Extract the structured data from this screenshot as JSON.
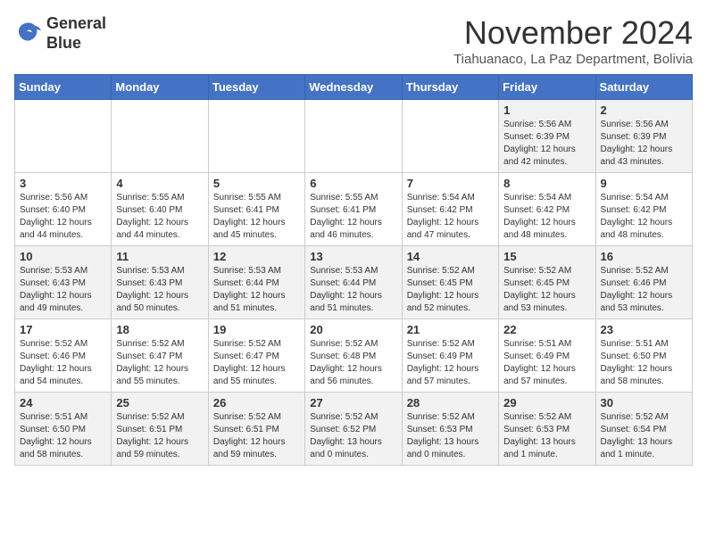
{
  "logo": {
    "line1": "General",
    "line2": "Blue"
  },
  "title": "November 2024",
  "subtitle": "Tiahuanaco, La Paz Department, Bolivia",
  "days_of_week": [
    "Sunday",
    "Monday",
    "Tuesday",
    "Wednesday",
    "Thursday",
    "Friday",
    "Saturday"
  ],
  "weeks": [
    [
      {
        "day": "",
        "info": ""
      },
      {
        "day": "",
        "info": ""
      },
      {
        "day": "",
        "info": ""
      },
      {
        "day": "",
        "info": ""
      },
      {
        "day": "",
        "info": ""
      },
      {
        "day": "1",
        "info": "Sunrise: 5:56 AM\nSunset: 6:39 PM\nDaylight: 12 hours\nand 42 minutes."
      },
      {
        "day": "2",
        "info": "Sunrise: 5:56 AM\nSunset: 6:39 PM\nDaylight: 12 hours\nand 43 minutes."
      }
    ],
    [
      {
        "day": "3",
        "info": "Sunrise: 5:56 AM\nSunset: 6:40 PM\nDaylight: 12 hours\nand 44 minutes."
      },
      {
        "day": "4",
        "info": "Sunrise: 5:55 AM\nSunset: 6:40 PM\nDaylight: 12 hours\nand 44 minutes."
      },
      {
        "day": "5",
        "info": "Sunrise: 5:55 AM\nSunset: 6:41 PM\nDaylight: 12 hours\nand 45 minutes."
      },
      {
        "day": "6",
        "info": "Sunrise: 5:55 AM\nSunset: 6:41 PM\nDaylight: 12 hours\nand 46 minutes."
      },
      {
        "day": "7",
        "info": "Sunrise: 5:54 AM\nSunset: 6:42 PM\nDaylight: 12 hours\nand 47 minutes."
      },
      {
        "day": "8",
        "info": "Sunrise: 5:54 AM\nSunset: 6:42 PM\nDaylight: 12 hours\nand 48 minutes."
      },
      {
        "day": "9",
        "info": "Sunrise: 5:54 AM\nSunset: 6:42 PM\nDaylight: 12 hours\nand 48 minutes."
      }
    ],
    [
      {
        "day": "10",
        "info": "Sunrise: 5:53 AM\nSunset: 6:43 PM\nDaylight: 12 hours\nand 49 minutes."
      },
      {
        "day": "11",
        "info": "Sunrise: 5:53 AM\nSunset: 6:43 PM\nDaylight: 12 hours\nand 50 minutes."
      },
      {
        "day": "12",
        "info": "Sunrise: 5:53 AM\nSunset: 6:44 PM\nDaylight: 12 hours\nand 51 minutes."
      },
      {
        "day": "13",
        "info": "Sunrise: 5:53 AM\nSunset: 6:44 PM\nDaylight: 12 hours\nand 51 minutes."
      },
      {
        "day": "14",
        "info": "Sunrise: 5:52 AM\nSunset: 6:45 PM\nDaylight: 12 hours\nand 52 minutes."
      },
      {
        "day": "15",
        "info": "Sunrise: 5:52 AM\nSunset: 6:45 PM\nDaylight: 12 hours\nand 53 minutes."
      },
      {
        "day": "16",
        "info": "Sunrise: 5:52 AM\nSunset: 6:46 PM\nDaylight: 12 hours\nand 53 minutes."
      }
    ],
    [
      {
        "day": "17",
        "info": "Sunrise: 5:52 AM\nSunset: 6:46 PM\nDaylight: 12 hours\nand 54 minutes."
      },
      {
        "day": "18",
        "info": "Sunrise: 5:52 AM\nSunset: 6:47 PM\nDaylight: 12 hours\nand 55 minutes."
      },
      {
        "day": "19",
        "info": "Sunrise: 5:52 AM\nSunset: 6:47 PM\nDaylight: 12 hours\nand 55 minutes."
      },
      {
        "day": "20",
        "info": "Sunrise: 5:52 AM\nSunset: 6:48 PM\nDaylight: 12 hours\nand 56 minutes."
      },
      {
        "day": "21",
        "info": "Sunrise: 5:52 AM\nSunset: 6:49 PM\nDaylight: 12 hours\nand 57 minutes."
      },
      {
        "day": "22",
        "info": "Sunrise: 5:51 AM\nSunset: 6:49 PM\nDaylight: 12 hours\nand 57 minutes."
      },
      {
        "day": "23",
        "info": "Sunrise: 5:51 AM\nSunset: 6:50 PM\nDaylight: 12 hours\nand 58 minutes."
      }
    ],
    [
      {
        "day": "24",
        "info": "Sunrise: 5:51 AM\nSunset: 6:50 PM\nDaylight: 12 hours\nand 58 minutes."
      },
      {
        "day": "25",
        "info": "Sunrise: 5:52 AM\nSunset: 6:51 PM\nDaylight: 12 hours\nand 59 minutes."
      },
      {
        "day": "26",
        "info": "Sunrise: 5:52 AM\nSunset: 6:51 PM\nDaylight: 12 hours\nand 59 minutes."
      },
      {
        "day": "27",
        "info": "Sunrise: 5:52 AM\nSunset: 6:52 PM\nDaylight: 13 hours\nand 0 minutes."
      },
      {
        "day": "28",
        "info": "Sunrise: 5:52 AM\nSunset: 6:53 PM\nDaylight: 13 hours\nand 0 minutes."
      },
      {
        "day": "29",
        "info": "Sunrise: 5:52 AM\nSunset: 6:53 PM\nDaylight: 13 hours\nand 1 minute."
      },
      {
        "day": "30",
        "info": "Sunrise: 5:52 AM\nSunset: 6:54 PM\nDaylight: 13 hours\nand 1 minute."
      }
    ]
  ]
}
